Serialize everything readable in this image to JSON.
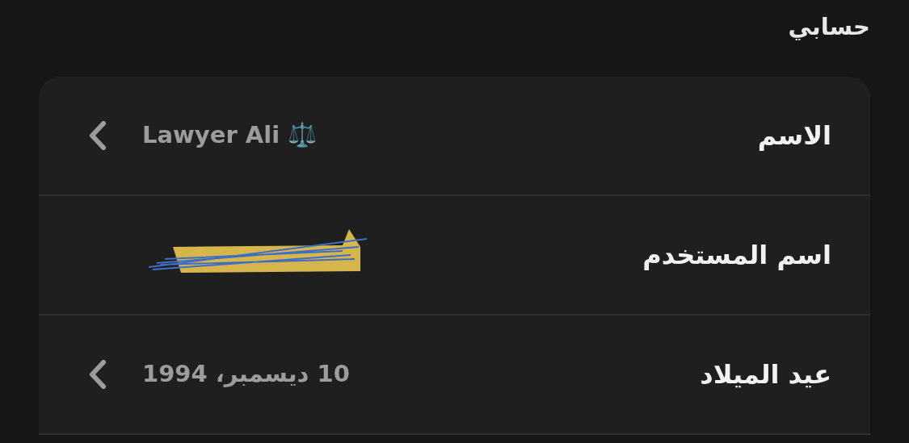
{
  "header": {
    "title": "حسابي"
  },
  "rows": [
    {
      "label": "الاسم",
      "value": "Lawyer Ali ⚖️",
      "kind": "link",
      "redacted": false
    },
    {
      "label": "اسم المستخدم",
      "kind": "static",
      "redacted": true
    },
    {
      "label": "عيد الميلاد",
      "value": "10 ديسمبر، 1994",
      "kind": "link",
      "redacted": false
    }
  ]
}
